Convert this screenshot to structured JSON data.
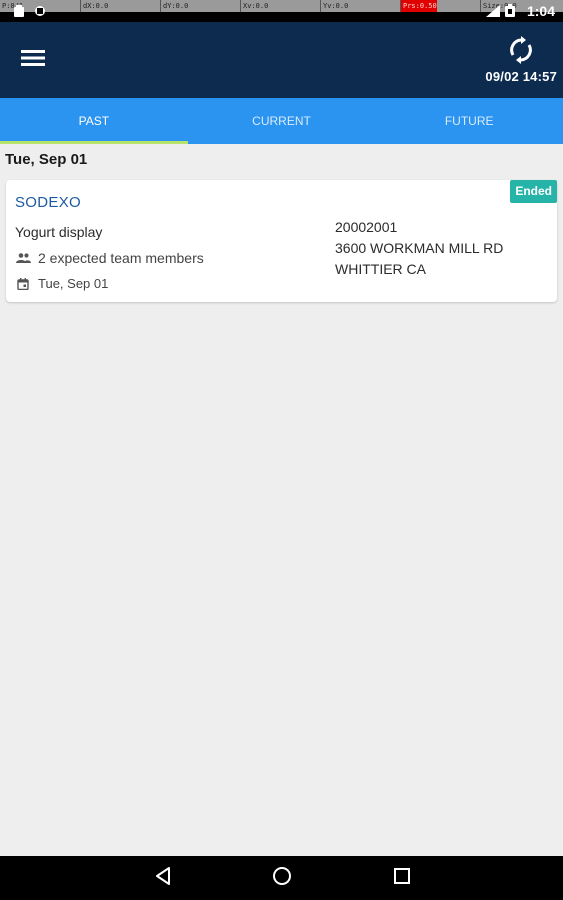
{
  "status_bar": {
    "time": "1:04",
    "debug": [
      "P:0/1",
      "dX:0.0",
      "dY:0.0",
      "Xv:0.0",
      "Yv:0.0",
      "Prs:0.50",
      "Size:0.0"
    ],
    "icons": [
      "notification-icon",
      "notification-icon",
      "wifi-icon",
      "battery-icon"
    ]
  },
  "app_bar": {
    "menu_icon": "hamburger-menu-icon",
    "sync_icon": "sync-icon",
    "last_sync": "09/02 14:57"
  },
  "tabs": [
    {
      "label": "PAST",
      "active": true
    },
    {
      "label": "CURRENT",
      "active": false
    },
    {
      "label": "FUTURE",
      "active": false
    }
  ],
  "content": {
    "section_date": "Tue, Sep 01",
    "cards": [
      {
        "client": "SODEXO",
        "status": "Ended",
        "task": "Yogurt display",
        "members": "2 expected team members",
        "date": "Tue, Sep 01",
        "store_number": "20002001",
        "street": "3600 WORKMAN MILL RD",
        "city": "WHITTIER CA"
      }
    ]
  },
  "colors": {
    "app_bar": "#0d2a4f",
    "tabs": "#2b93f0",
    "tab_indicator": "#b7e36b",
    "badge": "#26b3a8",
    "client_text": "#1d5aa5",
    "background": "#eeeeee"
  },
  "nav_bar": {
    "icons": [
      "back-icon",
      "home-icon",
      "recents-icon"
    ]
  }
}
